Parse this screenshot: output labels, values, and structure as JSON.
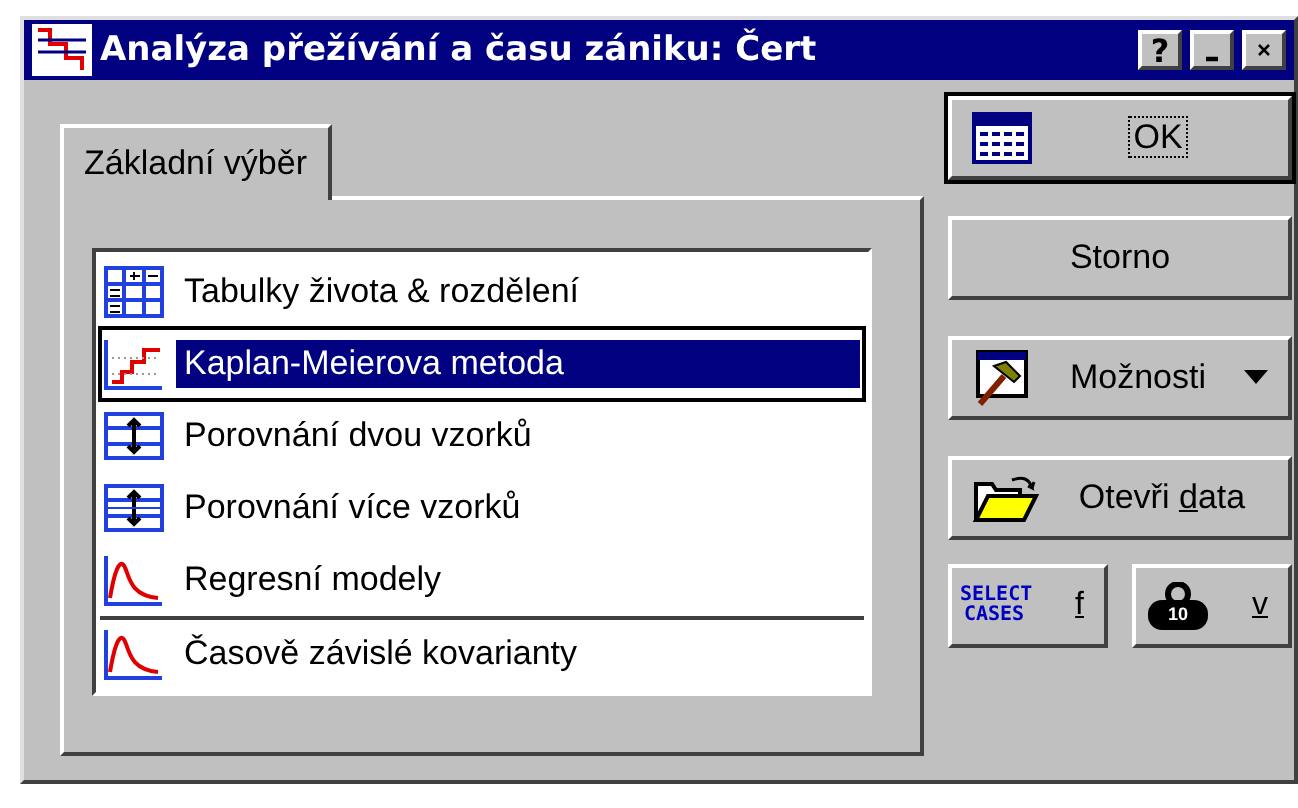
{
  "window": {
    "title": "Analýza přežívání a času zániku: Čert",
    "help": "?"
  },
  "tabs": [
    {
      "label": "Základní výběr",
      "selected": true
    }
  ],
  "list": {
    "items": [
      {
        "kind": "table",
        "label": "Tabulky života & rozdělení",
        "selected": false,
        "separator_before": false
      },
      {
        "kind": "steps",
        "label": "Kaplan-Meierova metoda",
        "selected": true,
        "separator_before": false
      },
      {
        "kind": "compare",
        "label": "Porovnání dvou vzorků",
        "selected": false,
        "separator_before": false
      },
      {
        "kind": "compare_many",
        "label": "Porovnání více vzorků",
        "selected": false,
        "separator_before": false
      },
      {
        "kind": "curve",
        "label": "Regresní modely",
        "selected": false,
        "separator_before": false
      },
      {
        "kind": "curve",
        "label": "Časově závislé kovarianty",
        "selected": false,
        "separator_before": true
      }
    ]
  },
  "buttons": [
    {
      "kind": "ok",
      "before": "OK",
      "focused": true
    },
    {
      "kind": "cancel",
      "before": "Storno",
      "focused": false
    },
    {
      "kind": "options",
      "before": "Možnosti",
      "focused": false
    },
    {
      "kind": "open",
      "before": "Otevři ",
      "mnemonic": "d",
      "after": "ata",
      "focused": false
    }
  ],
  "small_buttons": [
    {
      "kind": "select",
      "icon_text": "SELECT CASES",
      "mnemonic": "f"
    },
    {
      "kind": "weight",
      "icon_text": "10",
      "mnemonic": "v"
    }
  ]
}
